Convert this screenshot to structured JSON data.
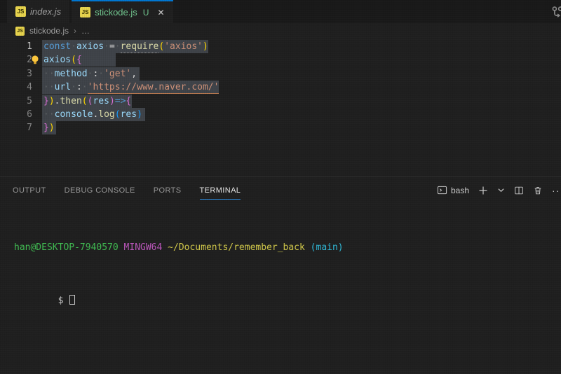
{
  "colors": {
    "keyword": "#569CD6",
    "variable": "#9CDCFE",
    "function": "#DCDCAA",
    "string": "#CE9178",
    "punct": "#D4D4D4",
    "b1": "#FFD700",
    "b2": "#DA70D6",
    "b3": "#179FFF",
    "ws": "#5d6164",
    "accent": "#0078D4",
    "selection": "#3f4349",
    "green": "#40bd52",
    "magenta": "#bd57bd",
    "yellow": "#d2c94a",
    "cyan": "#2fb9d8",
    "plain": "#cccccc"
  },
  "tabs": [
    {
      "label": "index.js",
      "state": "inactive"
    },
    {
      "label": "stickode.js",
      "git_badge": "U",
      "close": "✕",
      "state": "active"
    }
  ],
  "breadcrumb": {
    "file": "stickode.js",
    "separator": "›",
    "more": "…"
  },
  "editor": {
    "lines": [
      {
        "num": "1",
        "active": true,
        "sel": [
          60,
          297
        ],
        "tokens": [
          {
            "t": "const",
            "c": "keyword"
          },
          {
            "t": "·",
            "c": "ws"
          },
          {
            "t": "axios",
            "c": "variable"
          },
          {
            "t": "·",
            "c": "ws"
          },
          {
            "t": "=",
            "c": "punct"
          },
          {
            "t": "·",
            "c": "ws"
          },
          {
            "t": "require",
            "c": "function",
            "u": "dot"
          },
          {
            "t": "(",
            "c": "b1"
          },
          {
            "t": "'axios'",
            "c": "string"
          },
          {
            "t": ")",
            "c": "b1"
          }
        ]
      },
      {
        "num": "2",
        "sel": [
          60,
          165
        ],
        "tokens": [
          {
            "t": "axios",
            "c": "variable"
          },
          {
            "t": "(",
            "c": "b1"
          },
          {
            "t": "{",
            "c": "b2"
          }
        ]
      },
      {
        "num": "3",
        "sel": [
          60,
          199
        ],
        "tokens": [
          {
            "t": "··",
            "c": "ws"
          },
          {
            "t": "method",
            "c": "variable"
          },
          {
            "t": "·",
            "c": "ws"
          },
          {
            "t": ":",
            "c": "punct"
          },
          {
            "t": "·",
            "c": "ws"
          },
          {
            "t": "'get'",
            "c": "string"
          },
          {
            "t": ",",
            "c": "punct"
          }
        ]
      },
      {
        "num": "4",
        "sel": [
          60,
          312
        ],
        "tokens": [
          {
            "t": "··",
            "c": "ws"
          },
          {
            "t": "url",
            "c": "variable"
          },
          {
            "t": "·",
            "c": "ws"
          },
          {
            "t": ":",
            "c": "punct"
          },
          {
            "t": "·",
            "c": "ws"
          },
          {
            "t": "'https://www.naver.com/'",
            "c": "string",
            "u": "solid"
          }
        ]
      },
      {
        "num": "5",
        "sel": [
          60,
          188
        ],
        "tokens": [
          {
            "t": "}",
            "c": "b2"
          },
          {
            "t": ")",
            "c": "b1"
          },
          {
            "t": ".",
            "c": "punct"
          },
          {
            "t": "then",
            "c": "function"
          },
          {
            "t": "(",
            "c": "b1"
          },
          {
            "t": "(",
            "c": "b2"
          },
          {
            "t": "res",
            "c": "variable"
          },
          {
            "t": ")",
            "c": "b2"
          },
          {
            "t": "=>",
            "c": "keyword"
          },
          {
            "t": "{",
            "c": "b2"
          }
        ]
      },
      {
        "num": "6",
        "sel": [
          60,
          207
        ],
        "tokens": [
          {
            "t": "··",
            "c": "ws"
          },
          {
            "t": "console",
            "c": "variable"
          },
          {
            "t": ".",
            "c": "punct"
          },
          {
            "t": "log",
            "c": "function"
          },
          {
            "t": "(",
            "c": "b3"
          },
          {
            "t": "res",
            "c": "variable"
          },
          {
            "t": ")",
            "c": "b3"
          }
        ]
      },
      {
        "num": "7",
        "sel": [
          60,
          80
        ],
        "tokens": [
          {
            "t": "}",
            "c": "b2"
          },
          {
            "t": ")",
            "c": "b1"
          }
        ]
      }
    ]
  },
  "panel": {
    "tabs": [
      "OUTPUT",
      "DEBUG CONSOLE",
      "PORTS",
      "TERMINAL"
    ],
    "active_tab": "TERMINAL",
    "shell_label": "bash",
    "more_label": "···"
  },
  "terminal": {
    "line1": [
      {
        "t": "han@DESKTOP-7940570",
        "c": "green"
      },
      {
        "t": " ",
        "c": "plain"
      },
      {
        "t": "MINGW64",
        "c": "magenta"
      },
      {
        "t": " ",
        "c": "plain"
      },
      {
        "t": "~/Documents/remember_back",
        "c": "yellow"
      },
      {
        "t": " ",
        "c": "plain"
      },
      {
        "t": "(main)",
        "c": "cyan"
      }
    ],
    "prompt": "$"
  }
}
